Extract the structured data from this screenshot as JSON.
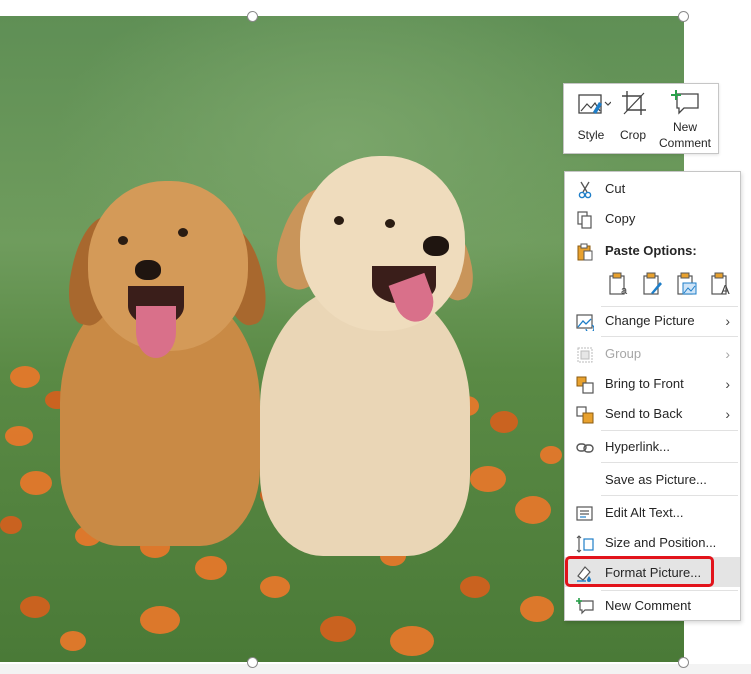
{
  "mini_toolbar": {
    "style_label": "Style",
    "crop_label": "Crop",
    "new_comment_label_line1": "New",
    "new_comment_label_line2": "Comment"
  },
  "context_menu": {
    "cut": "Cut",
    "copy": "Copy",
    "paste_options": "Paste Options:",
    "change_picture": "Change Picture",
    "group": "Group",
    "bring_to_front": "Bring to Front",
    "send_to_back": "Send to Back",
    "hyperlink": "Hyperlink...",
    "save_as_picture": "Save as Picture...",
    "edit_alt_text": "Edit Alt Text...",
    "size_and_position": "Size and Position...",
    "format_picture": "Format Picture...",
    "new_comment": "New Comment",
    "submenu_arrow": "›"
  },
  "colors": {
    "highlight_border": "#e2131b",
    "hover_background": "#e4e4e4",
    "icon_blue": "#1e7ec8",
    "icon_orange": "#e8a12e"
  }
}
